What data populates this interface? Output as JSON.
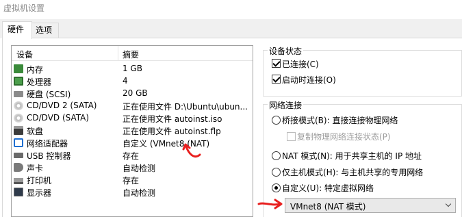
{
  "window": {
    "title": "虚拟机设置"
  },
  "tabs": [
    {
      "label": "硬件"
    },
    {
      "label": "选项"
    }
  ],
  "device_list": {
    "headers": {
      "device": "设备",
      "summary": "摘要"
    },
    "rows": [
      {
        "name": "内存",
        "summary": "1 GB",
        "icon": "memory-icon"
      },
      {
        "name": "处理器",
        "summary": "4",
        "icon": "processor-icon"
      },
      {
        "name": "硬盘 (SCSI)",
        "summary": "20 GB",
        "icon": "hard-disk-icon"
      },
      {
        "name": "CD/DVD 2 (SATA)",
        "summary": "正在使用文件 D:\\Ubuntu\\ubun...",
        "icon": "cd-dvd-icon"
      },
      {
        "name": "CD/DVD (SATA)",
        "summary": "正在使用文件 autoinst.iso",
        "icon": "cd-dvd-icon"
      },
      {
        "name": "软盘",
        "summary": "正在使用文件 autoinst.flp",
        "icon": "floppy-icon"
      },
      {
        "name": "网络适配器",
        "summary": "自定义 (VMnet8 (NAT)",
        "icon": "network-adapter-icon"
      },
      {
        "name": "USB 控制器",
        "summary": "存在",
        "icon": "usb-icon"
      },
      {
        "name": "声卡",
        "summary": "自动检测",
        "icon": "sound-card-icon"
      },
      {
        "name": "打印机",
        "summary": "存在",
        "icon": "printer-icon"
      },
      {
        "name": "显示器",
        "summary": "自动检测",
        "icon": "display-icon"
      }
    ]
  },
  "device_status": {
    "legend": "设备状态",
    "connected": {
      "label": "已连接(C)",
      "checked": true
    },
    "connect_at_power_on": {
      "label": "启动时连接(O)",
      "checked": true
    }
  },
  "network_connection": {
    "legend": "网络连接",
    "bridged": {
      "label": "桥接模式(B): 直接连接物理网络",
      "selected": false
    },
    "replicate": {
      "label": "复制物理网络连接状态(P)",
      "checked": false,
      "disabled": true
    },
    "nat": {
      "label": "NAT 模式(N): 用于共享主机的 IP 地址",
      "selected": false
    },
    "host_only": {
      "label": "仅主机模式(H): 与主机共享的专用网络",
      "selected": false
    },
    "custom": {
      "label": "自定义(U): 特定虚拟网络",
      "selected": true
    },
    "custom_network_select": {
      "value": "VMnet8 (NAT 模式)"
    }
  },
  "colors": {
    "annotation_arrow": "#e8201f",
    "selected_icon": "#1f6fd1"
  }
}
